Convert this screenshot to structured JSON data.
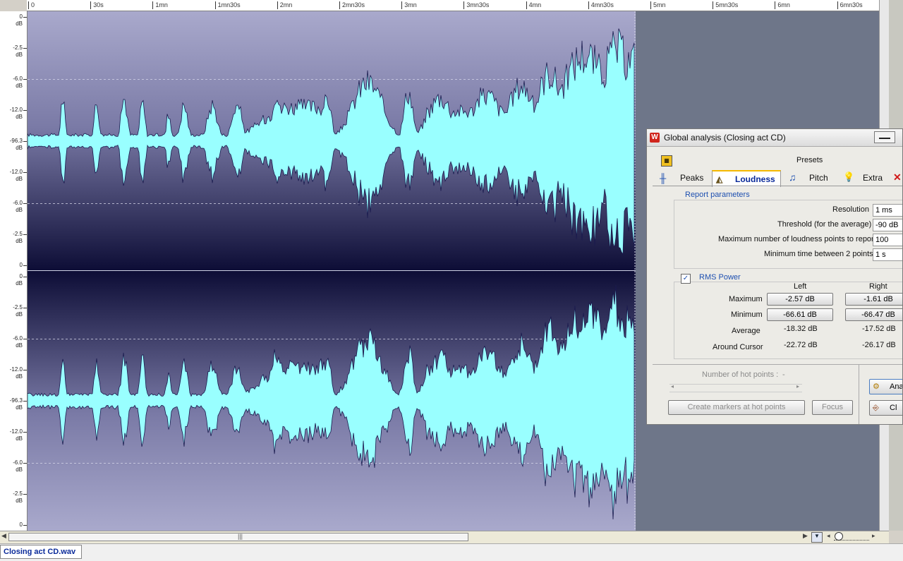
{
  "ruler": {
    "labels": [
      "0",
      "30s",
      "1mn",
      "1mn30s",
      "2mn",
      "2mn30s",
      "3mn",
      "3mn30s",
      "4mn",
      "4mn30s",
      "5mn",
      "5mn30s",
      "6mn",
      "6mn30s"
    ]
  },
  "y_axis": {
    "top_channel": [
      "0",
      "dB",
      "-2.5",
      "dB",
      "-6.0",
      "dB",
      "-12.0",
      "dB",
      "-96.3",
      "dB",
      "-12.0",
      "dB",
      "-6.0",
      "dB",
      "-2.5",
      "dB",
      "0"
    ],
    "labels": [
      "0",
      "-2.5",
      "-6.0",
      "-12.0",
      "-96.3",
      "-12.0",
      "-6.0",
      "-2.5",
      "0"
    ],
    "unit": "dB"
  },
  "colors": {
    "waveform": "#99ffff",
    "waveform_outline": "#1a1a4e",
    "background_top": "#a8a8cc",
    "background_bottom": "#10103a",
    "empty_area": "#6e7689",
    "accent_blue": "#1d4fb0"
  },
  "file_tab": {
    "label": "Closing act CD.wav"
  },
  "dialog": {
    "title": "Global analysis (Closing act CD)",
    "presets_label": "Presets",
    "tabs": [
      {
        "label": "Peaks",
        "icon": "peaks-icon"
      },
      {
        "label": "Loudness",
        "icon": "loudness-icon",
        "active": true
      },
      {
        "label": "Pitch",
        "icon": "pitch-icon"
      },
      {
        "label": "Extra",
        "icon": "lightbulb-icon"
      }
    ],
    "report": {
      "heading": "Report parameters",
      "resolution_label": "Resolution",
      "resolution_value": "1 ms",
      "threshold_label": "Threshold (for the average)",
      "threshold_value": "-90 dB",
      "max_points_label": "Maximum number of loudness points to report",
      "max_points_value": "100",
      "min_time_label": "Minimum time between 2 points",
      "min_time_value": "1 s"
    },
    "rms": {
      "label": "RMS Power",
      "checked": true,
      "col_left": "Left",
      "col_right": "Right",
      "rows": [
        {
          "label": "Maximum",
          "left": "-2.57 dB",
          "right": "-1.61 dB",
          "button": true
        },
        {
          "label": "Minimum",
          "left": "-66.61 dB",
          "right": "-66.47 dB",
          "button": true
        },
        {
          "label": "Average",
          "left": "-18.32 dB",
          "right": "-17.52 dB",
          "button": false
        },
        {
          "label": "Around Cursor",
          "left": "-22.72 dB",
          "right": "-26.17 dB",
          "button": false
        }
      ]
    },
    "hot_points_label": "Number of hot points :",
    "hot_points_value": "-",
    "create_markers_label": "Create markers at hot points",
    "focus_label": "Focus",
    "analyze_label": "Ana",
    "close_label": "Cl"
  }
}
